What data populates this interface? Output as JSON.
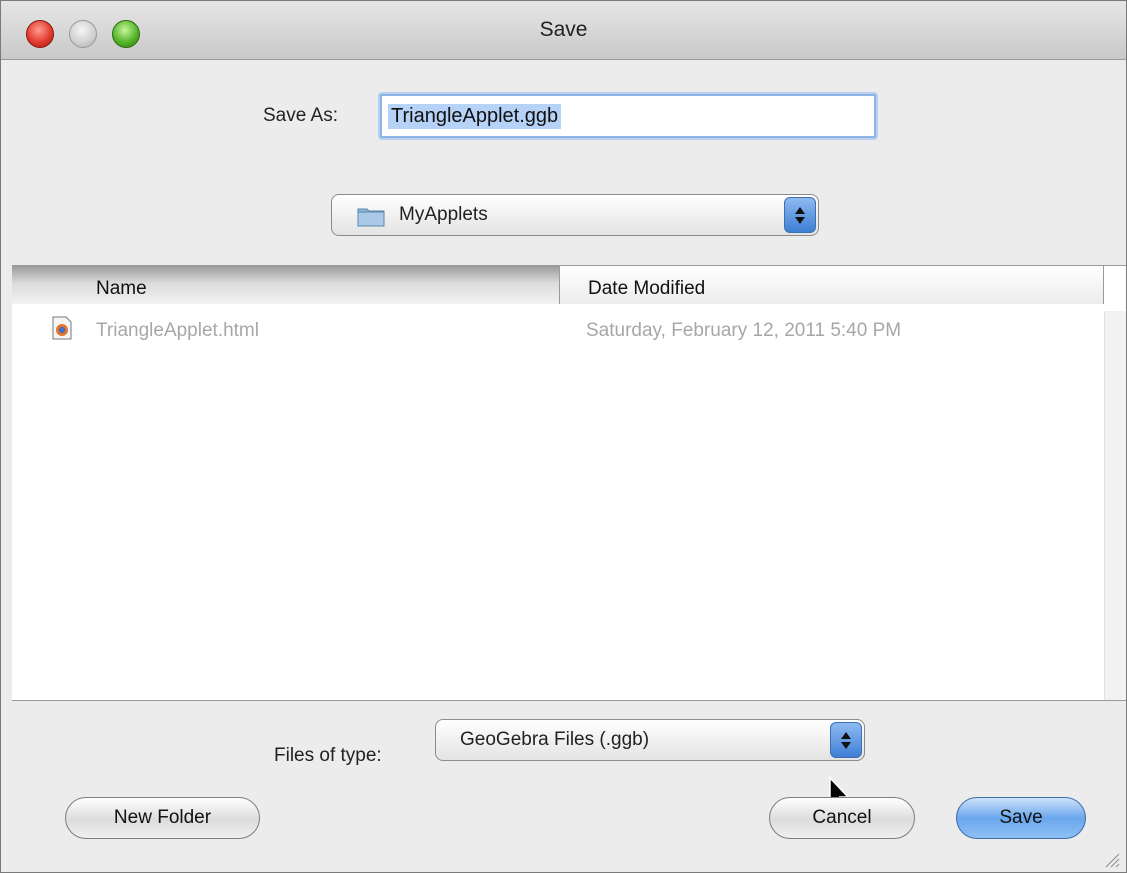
{
  "window": {
    "title": "Save"
  },
  "save_as": {
    "label": "Save As:",
    "value": "TriangleApplet.ggb"
  },
  "location": {
    "folder": "MyApplets",
    "icon": "folder-icon"
  },
  "browser": {
    "columns": [
      "Name",
      "Date Modified"
    ],
    "files": [
      {
        "name": "TriangleApplet.html",
        "date_modified": "Saturday, February 12, 2011 5:40 PM",
        "icon": "html-file-icon"
      }
    ]
  },
  "files_of_type": {
    "label": "Files of type:",
    "value": "GeoGebra Files (.ggb)"
  },
  "buttons": {
    "new_folder": "New Folder",
    "cancel": "Cancel",
    "save": "Save"
  },
  "colors": {
    "accent": "#6aa6ec",
    "selection": "#b6d2f6",
    "disabled_text": "#a7a7a7"
  }
}
